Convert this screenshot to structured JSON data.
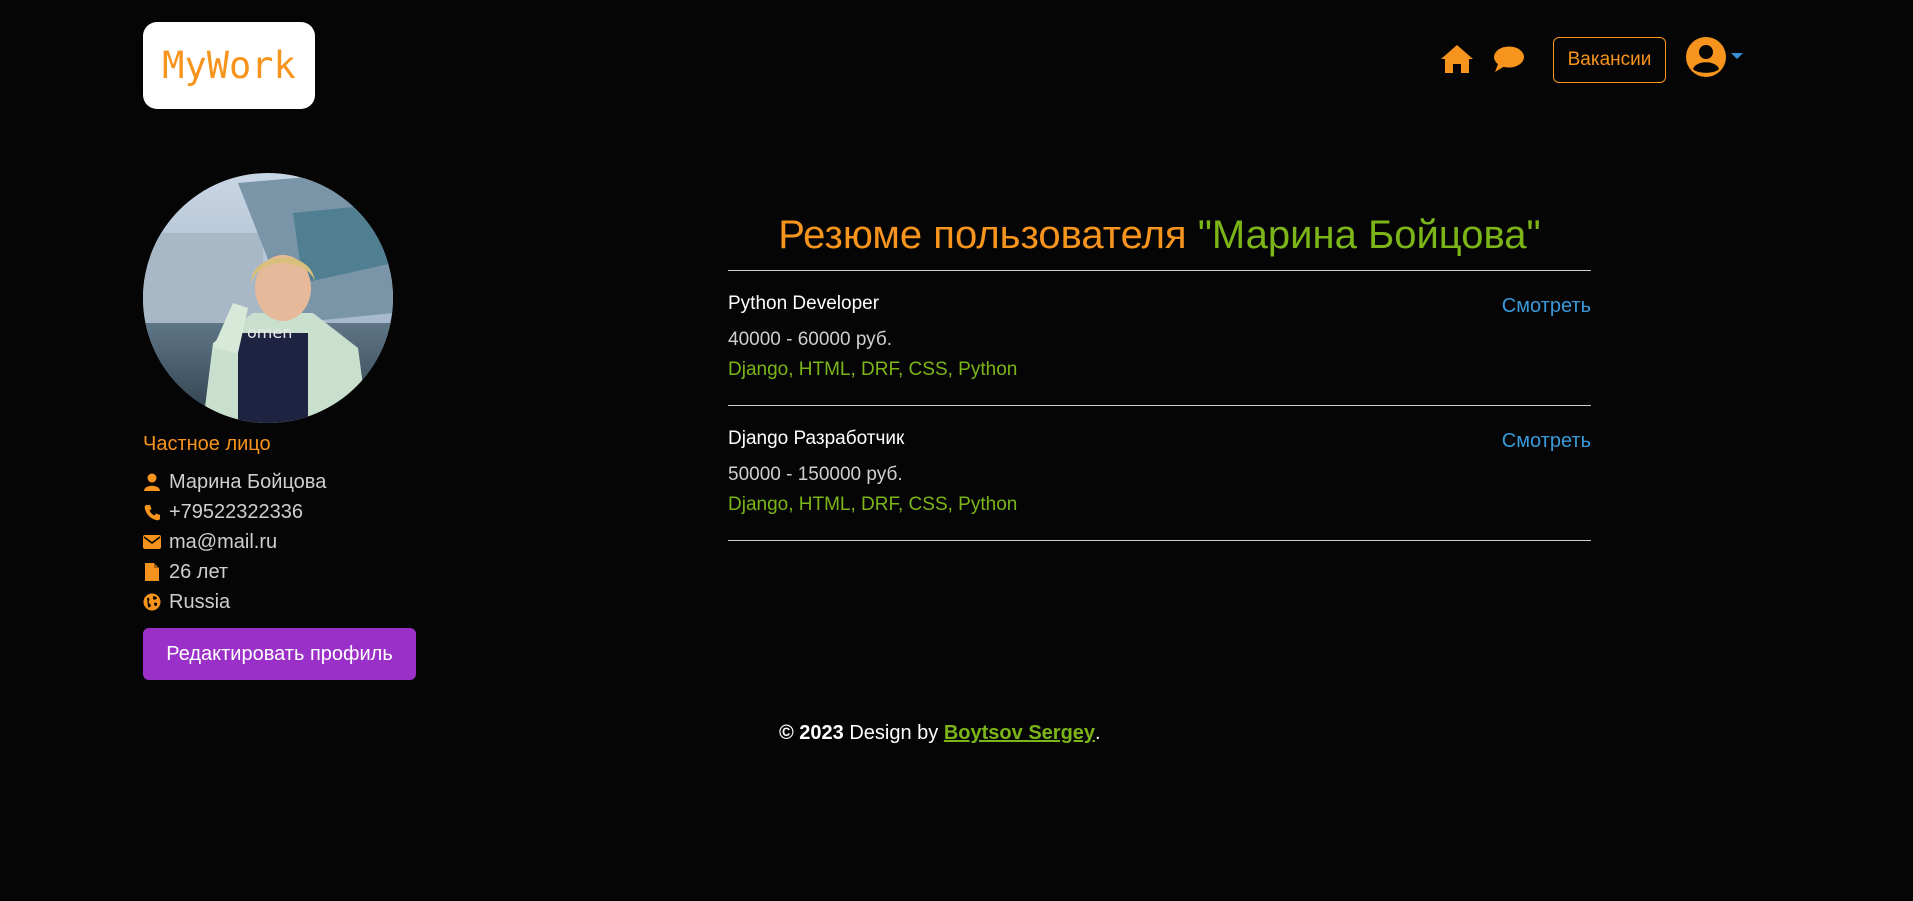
{
  "header": {
    "logo_text": "MyWork",
    "vacancies_label": "Вакансии",
    "accent_color": "#f7941d"
  },
  "icons": {
    "home": "home-icon",
    "chat": "chat-icon",
    "user": "user-circle-icon"
  },
  "profile": {
    "type_label": "Частное лицо",
    "name": "Марина Бойцова",
    "phone": "+79522322336",
    "email": "ma@mail.ru",
    "age": "26 лет",
    "country": "Russia",
    "edit_button": "Редактировать профиль"
  },
  "resumes": {
    "title_prefix": "Резюме пользователя ",
    "title_name": "\"Марина Бойцова\"",
    "items": [
      {
        "title": "Python Developer",
        "salary": "40000 - 60000 руб.",
        "skills": "Django, HTML, DRF, CSS, Python",
        "view_label": "Смотреть"
      },
      {
        "title": "Django Разработчик",
        "salary": "50000 - 150000 руб.",
        "skills": "Django, HTML, DRF, CSS, Python",
        "view_label": "Смотреть"
      }
    ]
  },
  "footer": {
    "copyright": "© 2023",
    "design_by": " Design by ",
    "author": "Boytsov Sergey",
    "end": "."
  }
}
